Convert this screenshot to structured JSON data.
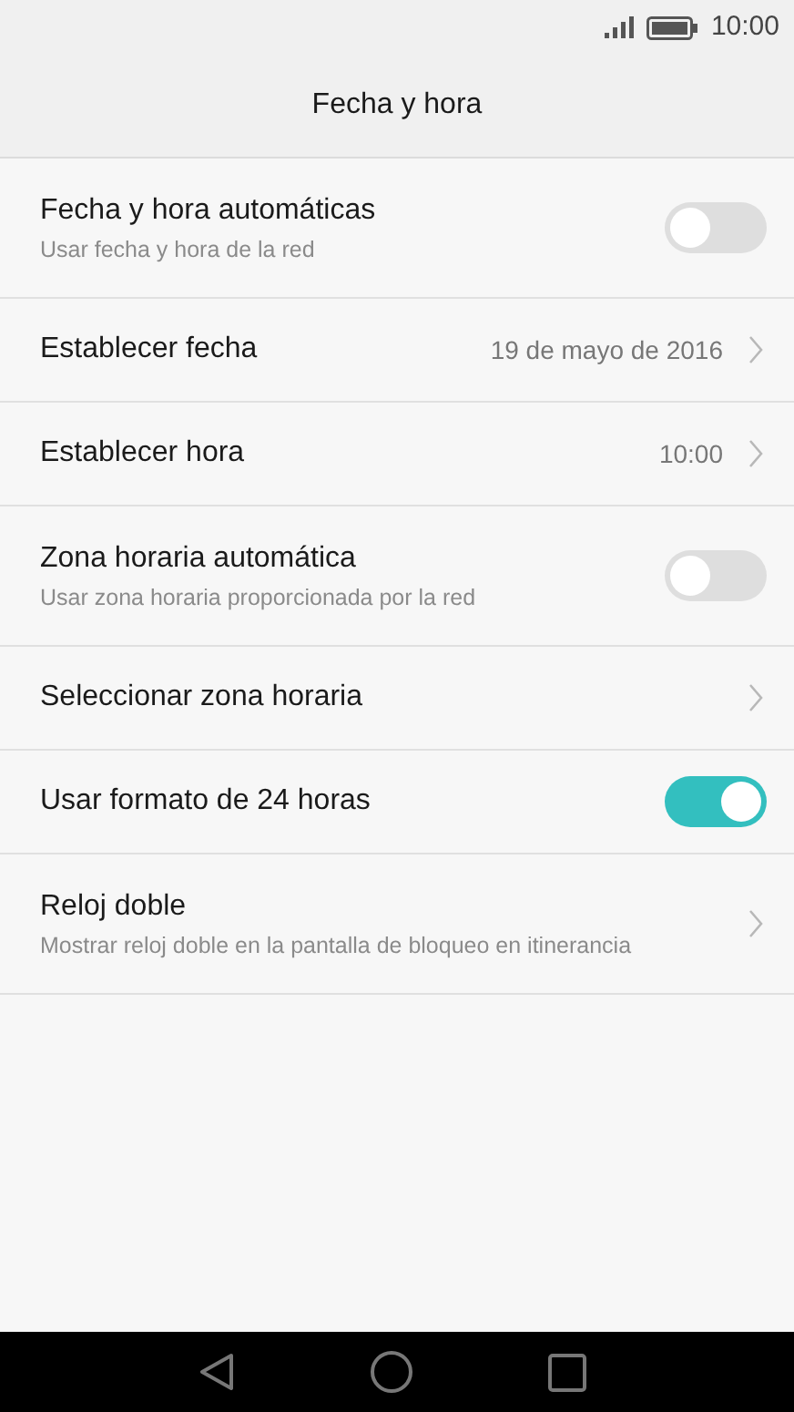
{
  "status_bar": {
    "time": "10:00"
  },
  "header": {
    "title": "Fecha y hora"
  },
  "settings": [
    {
      "kind": "toggle",
      "title": "Fecha y hora automáticas",
      "subtitle": "Usar fecha y hora de la red",
      "on": false
    },
    {
      "kind": "link",
      "title": "Establecer fecha",
      "value": "19 de mayo de 2016"
    },
    {
      "kind": "link",
      "title": "Establecer hora",
      "value": "10:00"
    },
    {
      "kind": "toggle",
      "title": "Zona horaria automática",
      "subtitle": "Usar zona horaria proporcionada por la red",
      "on": false
    },
    {
      "kind": "link",
      "title": "Seleccionar zona horaria"
    },
    {
      "kind": "toggle",
      "title": "Usar formato de 24 horas",
      "on": true
    },
    {
      "kind": "link",
      "title": "Reloj doble",
      "subtitle": "Mostrar reloj doble en la pantalla de bloqueo en itinerancia"
    }
  ]
}
